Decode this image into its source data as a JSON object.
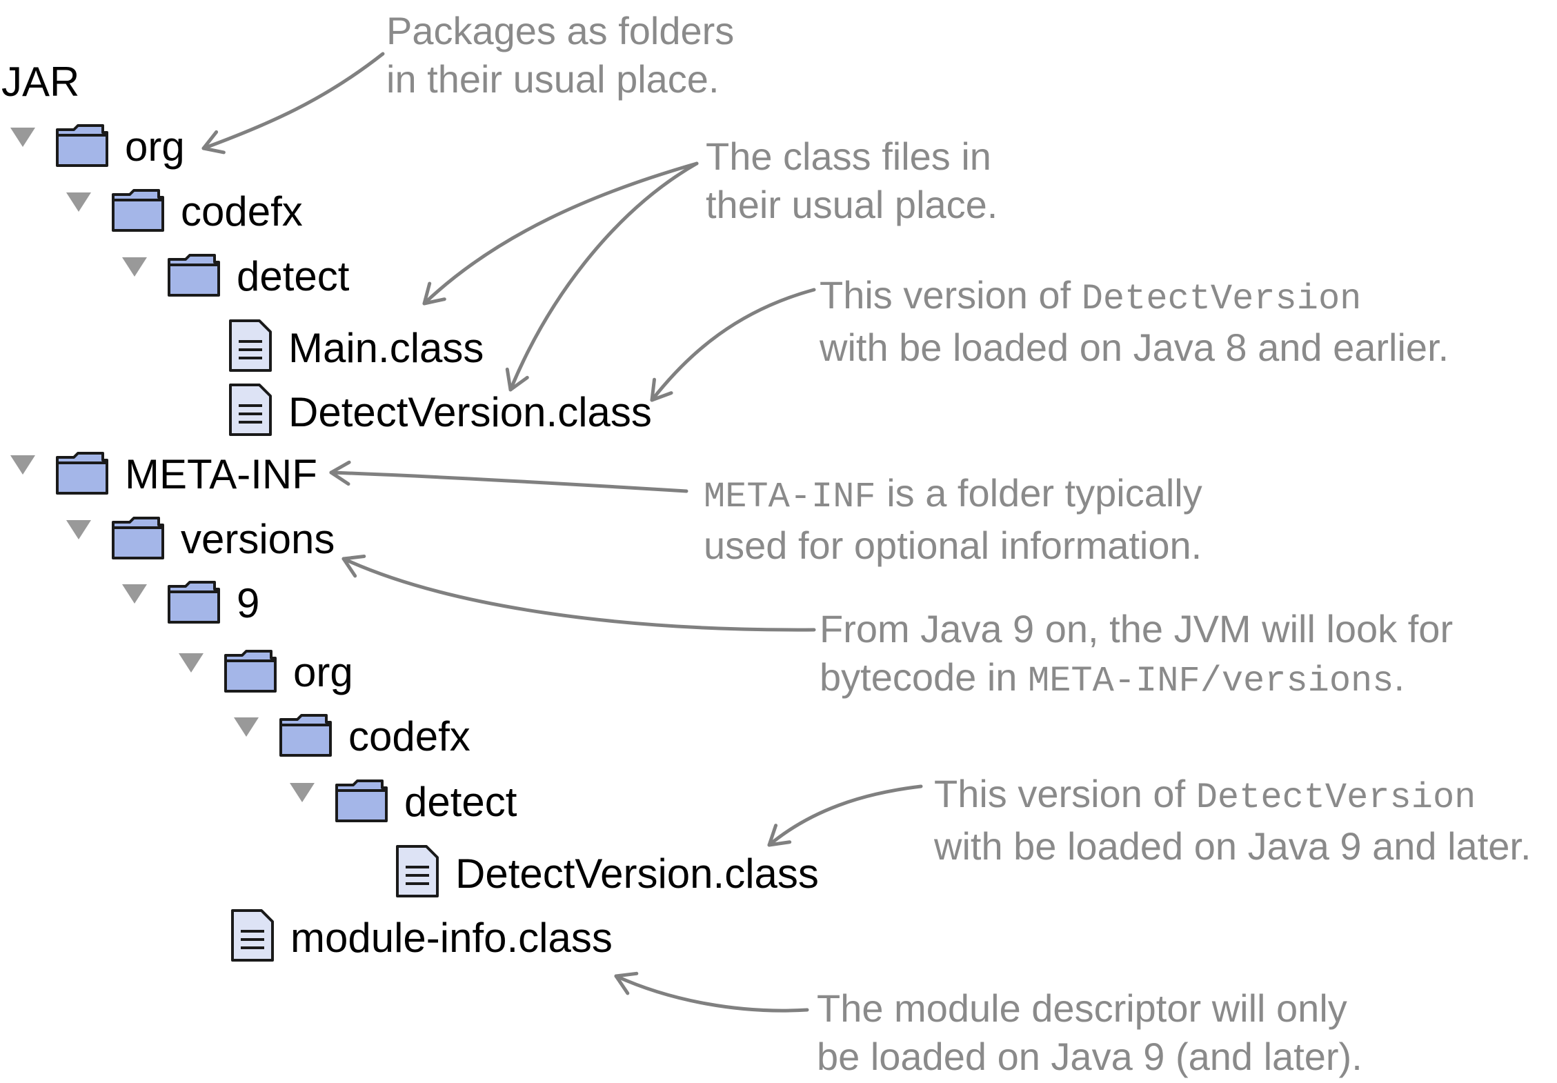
{
  "colors": {
    "folder_fill": "#a4b6e8",
    "file_fill": "#dde3f5",
    "outline": "#1a1a1a",
    "triangle": "#999999",
    "annotation": "#8a8a8a",
    "arrow": "#808080"
  },
  "tree": {
    "root_label": "JAR",
    "nodes": [
      {
        "label": "org",
        "kind": "folder",
        "icon": "folder-icon",
        "expanded": true
      },
      {
        "label": "codefx",
        "kind": "folder",
        "icon": "folder-icon",
        "expanded": true
      },
      {
        "label": "detect",
        "kind": "folder",
        "icon": "folder-icon",
        "expanded": true
      },
      {
        "label": "Main.class",
        "kind": "file",
        "icon": "file-icon"
      },
      {
        "label": "DetectVersion.class",
        "kind": "file",
        "icon": "file-icon"
      },
      {
        "label": "META-INF",
        "kind": "folder",
        "icon": "folder-icon",
        "expanded": true
      },
      {
        "label": "versions",
        "kind": "folder",
        "icon": "folder-icon",
        "expanded": true
      },
      {
        "label": "9",
        "kind": "folder",
        "icon": "folder-icon",
        "expanded": true
      },
      {
        "label": "org",
        "kind": "folder",
        "icon": "folder-icon",
        "expanded": true
      },
      {
        "label": "codefx",
        "kind": "folder",
        "icon": "folder-icon",
        "expanded": true
      },
      {
        "label": "detect",
        "kind": "folder",
        "icon": "folder-icon",
        "expanded": true
      },
      {
        "label": "DetectVersion.class",
        "kind": "file",
        "icon": "file-icon"
      },
      {
        "label": "module-info.class",
        "kind": "file",
        "icon": "file-icon"
      }
    ]
  },
  "annotations": [
    {
      "id": "packages",
      "lines": [
        [
          {
            "t": "Packages as folders"
          }
        ],
        [
          {
            "t": "in their usual place."
          }
        ]
      ]
    },
    {
      "id": "classfiles",
      "lines": [
        [
          {
            "t": "The class files in"
          }
        ],
        [
          {
            "t": "their usual place."
          }
        ]
      ]
    },
    {
      "id": "java8",
      "lines": [
        [
          {
            "t": "This version of "
          },
          {
            "t": "DetectVersion",
            "mono": true
          }
        ],
        [
          {
            "t": "with be loaded on Java 8 and earlier."
          }
        ]
      ]
    },
    {
      "id": "metainf",
      "lines": [
        [
          {
            "t": "META-INF",
            "mono": true
          },
          {
            "t": " is a folder typically"
          }
        ],
        [
          {
            "t": "used for optional information."
          }
        ]
      ]
    },
    {
      "id": "java9on",
      "lines": [
        [
          {
            "t": "From Java 9 on, the JVM will look for"
          }
        ],
        [
          {
            "t": "bytecode in "
          },
          {
            "t": "META-INF/versions",
            "mono": true
          },
          {
            "t": "."
          }
        ]
      ]
    },
    {
      "id": "java9",
      "lines": [
        [
          {
            "t": "This version of "
          },
          {
            "t": "DetectVersion",
            "mono": true
          }
        ],
        [
          {
            "t": "with be loaded on Java 9 and later."
          }
        ]
      ]
    },
    {
      "id": "moduledesc",
      "lines": [
        [
          {
            "t": "The module descriptor will only"
          }
        ],
        [
          {
            "t": "be loaded on Java 9 (and later)."
          }
        ]
      ]
    }
  ]
}
